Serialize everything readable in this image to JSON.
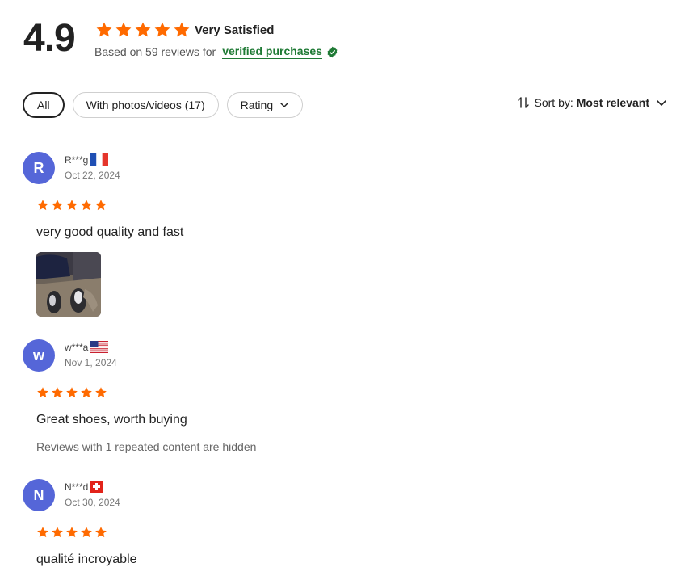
{
  "summary": {
    "score": "4.9",
    "stars": 5,
    "label": "Very Satisfied",
    "based_on_text": "Based on 59 reviews for",
    "verified_link": "verified purchases"
  },
  "filters": {
    "all": "All",
    "photos": "With photos/videos (17)",
    "rating": "Rating"
  },
  "sort": {
    "label": "Sort by:",
    "value": "Most relevant"
  },
  "colors": {
    "star": "#ff6a00",
    "verified": "#1f7a35",
    "avatar": "#5566d8"
  },
  "reviews": [
    {
      "initial": "R",
      "name": "R***g",
      "flag": "france-flag-icon",
      "date": "Oct 22, 2024",
      "rating": 5,
      "text": "very good quality and fast",
      "has_photo": true
    },
    {
      "initial": "w",
      "name": "w***a",
      "flag": "usa-flag-icon",
      "date": "Nov 1, 2024",
      "rating": 5,
      "text": "Great shoes, worth buying",
      "note": "Reviews with 1 repeated content are hidden"
    },
    {
      "initial": "N",
      "name": "N***d",
      "flag": "switzerland-flag-icon",
      "date": "Oct 30, 2024",
      "rating": 5,
      "text": "qualité incroyable"
    }
  ]
}
